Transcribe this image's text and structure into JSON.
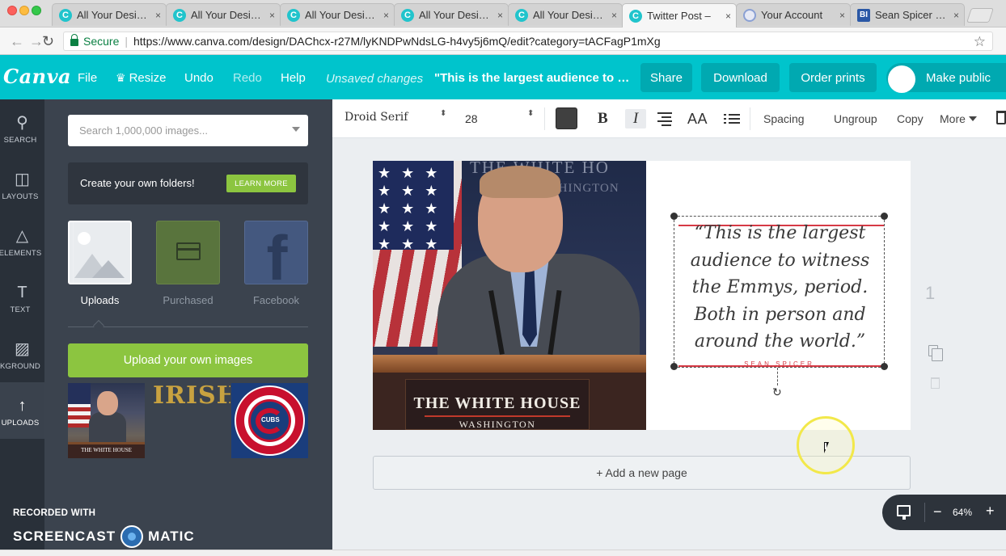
{
  "browser": {
    "tabs": [
      {
        "label": "All Your Designs",
        "favicon": "canva-icon"
      },
      {
        "label": "All Your Designs",
        "favicon": "canva-icon"
      },
      {
        "label": "All Your Designs",
        "favicon": "canva-icon"
      },
      {
        "label": "All Your Designs",
        "favicon": "canva-icon"
      },
      {
        "label": "All Your Designs",
        "favicon": "canva-icon"
      },
      {
        "label": "Twitter Post – ",
        "favicon": "canva-icon",
        "active": true
      },
      {
        "label": "Your Account",
        "favicon": "account-icon"
      },
      {
        "label": "Sean Spicer me",
        "favicon": "business-insider-icon"
      }
    ],
    "tab_close": "×",
    "favicon_canva_letter": "C",
    "favicon_bi_letters": "BI",
    "nav": {
      "back": "←",
      "forward": "→",
      "reload": "↻"
    },
    "secure_label": "Secure",
    "url_separator": "|",
    "url": "https://www.canva.com/design/DAChcx-r27M/lyKNDPwNdsLG-h4vy5j6mQ/edit?category=tACFagP1mXg",
    "bookmark_icon": "☆"
  },
  "canva_bar": {
    "logo": "Canva",
    "menu": {
      "file": "File",
      "resize": "Resize",
      "undo": "Undo",
      "redo": "Redo",
      "help": "Help"
    },
    "crown_icon": "♛",
    "status": "Unsaved changes",
    "doc_title": "\"This is the largest audience to witness the Emmys, period.",
    "buttons": {
      "share": "Share",
      "download": "Download",
      "order_prints": "Order prints",
      "make_public": "Make public"
    },
    "accent": "#00c4cc"
  },
  "rail": {
    "items": [
      {
        "label": "SEARCH",
        "icon": "⚲"
      },
      {
        "label": "LAYOUTS",
        "icon": "◫"
      },
      {
        "label": "ELEMENTS",
        "icon": "△"
      },
      {
        "label": "TEXT",
        "icon": "T"
      },
      {
        "label": "KGROUND",
        "icon": "▨"
      },
      {
        "label": "UPLOADS",
        "icon": "↑",
        "active": true
      }
    ]
  },
  "panel": {
    "search_placeholder": "Search 1,000,000 images...",
    "folders_text": "Create your own folders!",
    "learn_more": "LEARN MORE",
    "folders": {
      "uploads": "Uploads",
      "purchased": "Purchased",
      "facebook": "Facebook"
    },
    "facebook_glyph": "f",
    "upload_button": "Upload your own images",
    "thumb_irish": "IRISH",
    "thumb_spicer_caption": "THE WHITE HOUSE",
    "thumb_cubs_text": "CUBS",
    "recorded_with": "RECORDED WITH",
    "screencast_left": "SCREENCAST",
    "screencast_right": "MATIC",
    "green": "#8cc540"
  },
  "toolbar": {
    "font": "Droid Serif",
    "spin": "⬍",
    "size": "28",
    "bold": "B",
    "italic": "I",
    "aa": "AA",
    "spacing": "Spacing",
    "ungroup": "Ungroup",
    "copy": "Copy",
    "more": "More",
    "text_color": "#404040"
  },
  "canvas": {
    "photo": {
      "seal_1": "THE WHITE HO",
      "seal_2": "WASHINGTON",
      "stars": "★ ★ ★ ★ ★ ★ ★ ★ ★ ★ ★ ★ ★ ★ ★ ★ ★ ★",
      "plaque_1": "THE WHITE HOUSE",
      "plaque_2": "WASHINGTON"
    },
    "quote": "“This is the largest audience to witness the Emmys, period. Both in person and around the world.”",
    "byline": "SEAN SPICER",
    "rotate_icon": "↻",
    "page_number": "1",
    "add_page": "+ Add a new page"
  },
  "zoom": {
    "minus": "−",
    "value": "64%",
    "plus": "+"
  }
}
